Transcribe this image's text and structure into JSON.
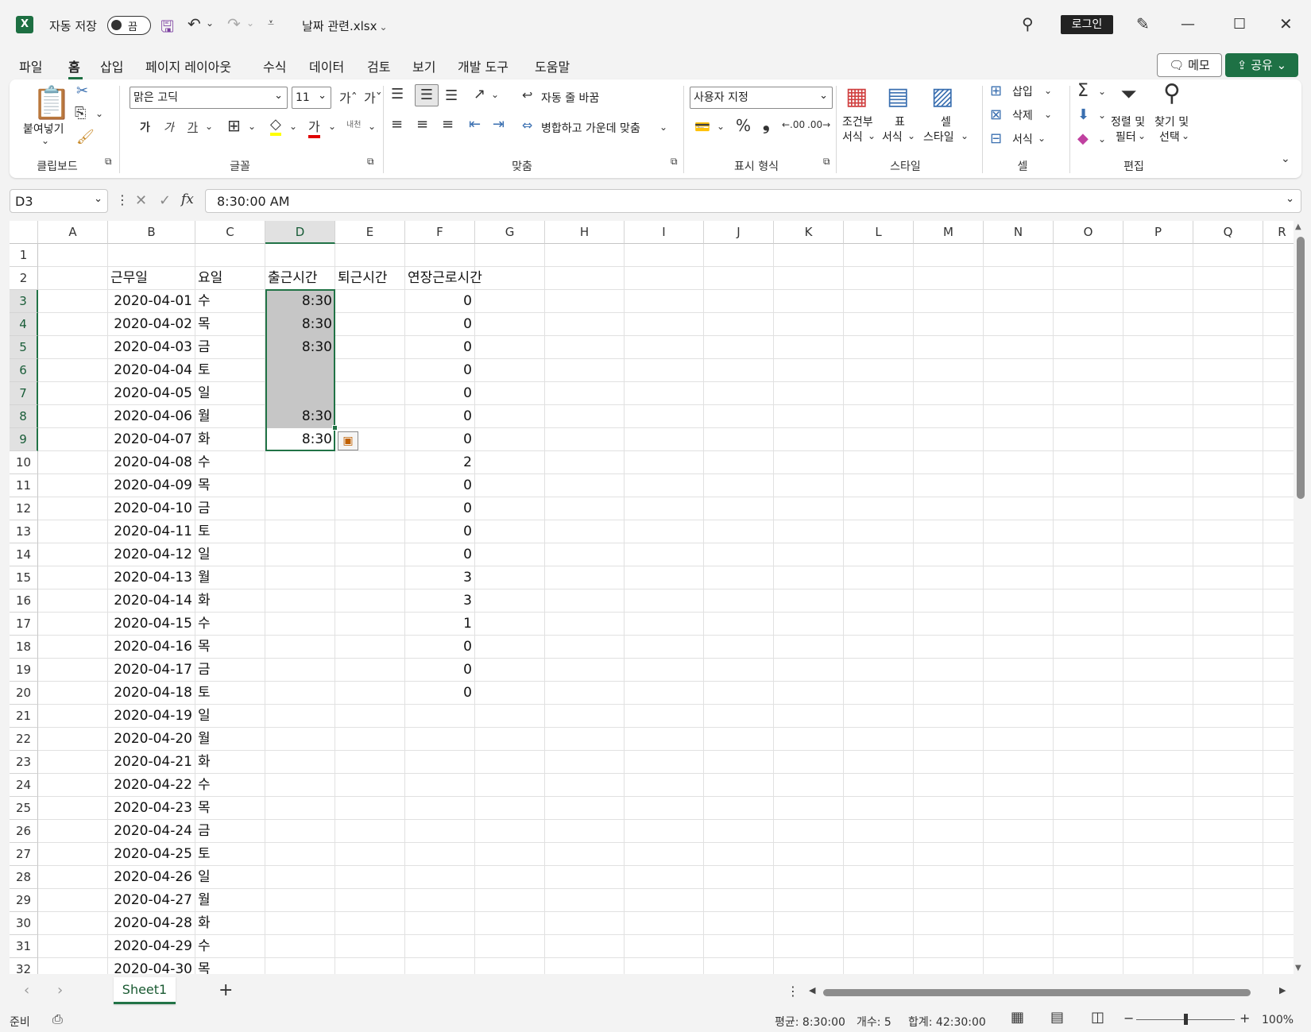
{
  "titlebar": {
    "app_icon": "excel-icon",
    "autosave_label": "자동 저장",
    "autosave_state": "끔",
    "filename": "날짜 관련.xlsx",
    "signin": "로그인"
  },
  "menu": {
    "tabs": [
      "파일",
      "홈",
      "삽입",
      "페이지 레이아웃",
      "수식",
      "데이터",
      "검토",
      "보기",
      "개발 도구",
      "도움말"
    ],
    "active": "홈",
    "memo": "메모",
    "share": "공유"
  },
  "ribbon": {
    "clipboard": {
      "label": "클립보드",
      "paste": "붙여넣기"
    },
    "font": {
      "label": "글꼴",
      "name": "맑은 고딕",
      "size": "11",
      "bold": "가",
      "italic": "가",
      "underline": "가",
      "color_a": "가",
      "phonetic": "내천"
    },
    "align": {
      "label": "맞춤",
      "wrap": "자동 줄 바꿈",
      "merge": "병합하고 가운데 맞춤"
    },
    "number": {
      "label": "표시 형식",
      "format": "사용자 지정",
      "percent": "%",
      "comma": "❟"
    },
    "styles": {
      "label": "스타일",
      "cond1": "조건부",
      "cond2": "서식",
      "table1": "표",
      "table2": "서식",
      "cell1": "셀",
      "cell2": "스타일"
    },
    "cells": {
      "label": "셀",
      "insert": "삽입",
      "delete": "삭제",
      "format": "서식"
    },
    "editing": {
      "label": "편집",
      "sort1": "정렬 및",
      "sort2": "필터",
      "find1": "찾기 및",
      "find2": "선택"
    }
  },
  "formula": {
    "namebox": "D3",
    "fx": "fx",
    "value": "8:30:00 AM"
  },
  "grid": {
    "columns": [
      "A",
      "B",
      "C",
      "D",
      "E",
      "F",
      "G",
      "H",
      "I",
      "J",
      "K",
      "L",
      "M",
      "N",
      "O",
      "P",
      "Q",
      "R"
    ],
    "selected_col": "D",
    "headers": {
      "B": "근무일",
      "C": "요일",
      "D": "출근시간",
      "E": "퇴근시간",
      "F": "연장근로시간"
    },
    "rows": [
      {
        "n": "3",
        "b": "2020-04-01",
        "c": "수",
        "d": "8:30",
        "f": "0"
      },
      {
        "n": "4",
        "b": "2020-04-02",
        "c": "목",
        "d": "8:30",
        "f": "0"
      },
      {
        "n": "5",
        "b": "2020-04-03",
        "c": "금",
        "d": "8:30",
        "f": "0"
      },
      {
        "n": "6",
        "b": "2020-04-04",
        "c": "토",
        "d": "",
        "f": "0"
      },
      {
        "n": "7",
        "b": "2020-04-05",
        "c": "일",
        "d": "",
        "f": "0"
      },
      {
        "n": "8",
        "b": "2020-04-06",
        "c": "월",
        "d": "8:30",
        "f": "0"
      },
      {
        "n": "9",
        "b": "2020-04-07",
        "c": "화",
        "d": "8:30",
        "f": "0"
      },
      {
        "n": "10",
        "b": "2020-04-08",
        "c": "수",
        "d": "",
        "f": "2"
      },
      {
        "n": "11",
        "b": "2020-04-09",
        "c": "목",
        "d": "",
        "f": "0"
      },
      {
        "n": "12",
        "b": "2020-04-10",
        "c": "금",
        "d": "",
        "f": "0"
      },
      {
        "n": "13",
        "b": "2020-04-11",
        "c": "토",
        "d": "",
        "f": "0"
      },
      {
        "n": "14",
        "b": "2020-04-12",
        "c": "일",
        "d": "",
        "f": "0"
      },
      {
        "n": "15",
        "b": "2020-04-13",
        "c": "월",
        "d": "",
        "f": "3"
      },
      {
        "n": "16",
        "b": "2020-04-14",
        "c": "화",
        "d": "",
        "f": "3"
      },
      {
        "n": "17",
        "b": "2020-04-15",
        "c": "수",
        "d": "",
        "f": "1"
      },
      {
        "n": "18",
        "b": "2020-04-16",
        "c": "목",
        "d": "",
        "f": "0"
      },
      {
        "n": "19",
        "b": "2020-04-17",
        "c": "금",
        "d": "",
        "f": "0"
      },
      {
        "n": "20",
        "b": "2020-04-18",
        "c": "토",
        "d": "",
        "f": "0"
      },
      {
        "n": "21",
        "b": "2020-04-19",
        "c": "일",
        "d": "",
        "f": ""
      },
      {
        "n": "22",
        "b": "2020-04-20",
        "c": "월",
        "d": "",
        "f": ""
      },
      {
        "n": "23",
        "b": "2020-04-21",
        "c": "화",
        "d": "",
        "f": ""
      },
      {
        "n": "24",
        "b": "2020-04-22",
        "c": "수",
        "d": "",
        "f": ""
      },
      {
        "n": "25",
        "b": "2020-04-23",
        "c": "목",
        "d": "",
        "f": ""
      },
      {
        "n": "26",
        "b": "2020-04-24",
        "c": "금",
        "d": "",
        "f": ""
      },
      {
        "n": "27",
        "b": "2020-04-25",
        "c": "토",
        "d": "",
        "f": ""
      },
      {
        "n": "28",
        "b": "2020-04-26",
        "c": "일",
        "d": "",
        "f": ""
      },
      {
        "n": "29",
        "b": "2020-04-27",
        "c": "월",
        "d": "",
        "f": ""
      },
      {
        "n": "30",
        "b": "2020-04-28",
        "c": "화",
        "d": "",
        "f": ""
      },
      {
        "n": "31",
        "b": "2020-04-29",
        "c": "수",
        "d": "",
        "f": ""
      },
      {
        "n": "32",
        "b": "2020-04-30",
        "c": "목",
        "d": "",
        "f": ""
      }
    ]
  },
  "sheets": {
    "tabs": [
      "Sheet1"
    ],
    "active": "Sheet1",
    "add": "+"
  },
  "status": {
    "ready": "준비",
    "average": "평균: 8:30:00",
    "count": "개수: 5",
    "sum": "합계: 42:30:00",
    "zoom": "100%"
  },
  "colors": {
    "accent": "#217346",
    "share": "#1e7145",
    "selection": "#c6c6c6"
  }
}
